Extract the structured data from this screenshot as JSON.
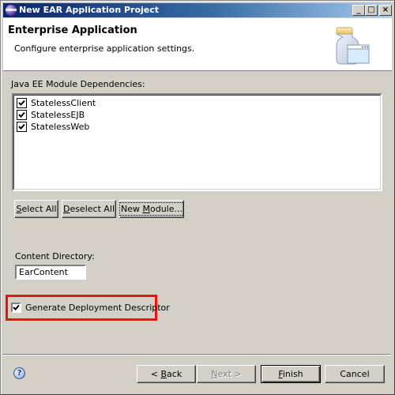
{
  "window": {
    "title": "New EAR Application Project",
    "controls": {
      "minimize": "_",
      "maximize": "□",
      "close": "×"
    }
  },
  "header": {
    "title": "Enterprise Application",
    "description": "Configure enterprise application settings.",
    "icon": "jar-window-icon"
  },
  "modules": {
    "label": "Java EE Module Dependencies:",
    "items": [
      {
        "label": "StatelessClient",
        "checked": true
      },
      {
        "label": "StatelessEJB",
        "checked": true
      },
      {
        "label": "StatelessWeb",
        "checked": true
      }
    ],
    "buttons": {
      "select_all": {
        "mnemonic": "S",
        "rest": "elect All"
      },
      "deselect_all": {
        "mnemonic": "D",
        "rest": "eselect All"
      },
      "new_module": {
        "before": "New ",
        "mnemonic": "M",
        "rest": "odule..."
      }
    }
  },
  "content_directory": {
    "label": "Content Directory:",
    "value": "EarContent"
  },
  "generate_descriptor": {
    "label": "Generate Deployment Descriptor",
    "checked": true,
    "highlight_color": "#ee1111"
  },
  "footer": {
    "help_icon": "?",
    "back": {
      "before": "< ",
      "mnemonic": "B",
      "rest": "ack"
    },
    "next": {
      "mnemonic": "N",
      "rest": "ext >"
    },
    "finish": {
      "mnemonic": "F",
      "rest": "inish"
    },
    "cancel": "Cancel"
  }
}
